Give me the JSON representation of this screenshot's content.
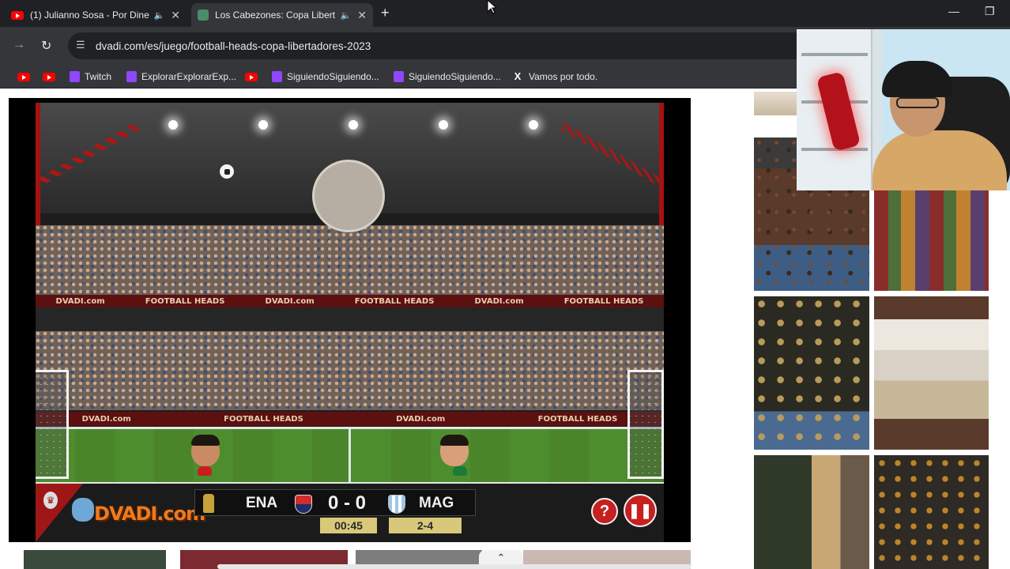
{
  "browser": {
    "tabs": [
      {
        "title": "(1) Julianno Sosa - Por Dine",
        "active": false
      },
      {
        "title": "Los Cabezones: Copa Libert",
        "active": true
      }
    ],
    "address": "dvadi.com/es/juego/football-heads-copa-libertadores-2023"
  },
  "bookmarks": [
    {
      "label": "",
      "icon": "youtube-icon"
    },
    {
      "label": "",
      "icon": "youtube-icon"
    },
    {
      "label": "Twitch",
      "icon": "twitch-icon"
    },
    {
      "label": "ExplorarExplorarExp...",
      "icon": "twitch-icon"
    },
    {
      "label": "",
      "icon": "youtube-icon"
    },
    {
      "label": "SiguiendoSiguiendo...",
      "icon": "twitch-icon"
    },
    {
      "label": "SiguiendoSiguiendo...",
      "icon": "twitch-icon"
    },
    {
      "label": "Vamos por todo.",
      "icon": "x-icon"
    }
  ],
  "game": {
    "banner_brand": "DVADI.com",
    "banner_title": "FOOTBALL HEADS",
    "logo": "DVADI.com",
    "team_left": "ENA",
    "team_right": "MAG",
    "score": "0 - 0",
    "timer": "00:45",
    "aggregate": "2-4",
    "help_button": "?"
  },
  "colors": {
    "chrome_dark": "#202124",
    "chrome_toolbar": "#35363a",
    "game_red": "#c62020",
    "pitch_green": "#4e8d2e",
    "dvadi_orange": "#ef7a1c"
  }
}
